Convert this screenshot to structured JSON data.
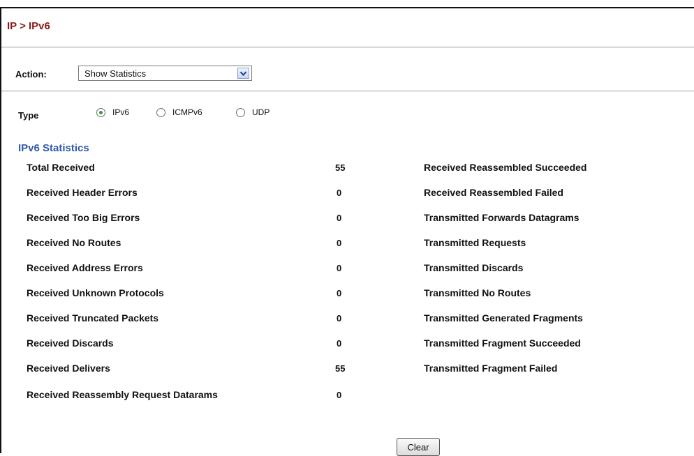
{
  "breadcrumb": "IP > IPv6",
  "action": {
    "label": "Action:",
    "selected": "Show Statistics"
  },
  "type": {
    "label": "Type",
    "options": [
      "IPv6",
      "ICMPv6",
      "UDP"
    ],
    "selected": "IPv6"
  },
  "section_title": "IPv6 Statistics",
  "left_stats": [
    {
      "label": "Total Received",
      "value": "55"
    },
    {
      "label": "Received Header Errors",
      "value": "0"
    },
    {
      "label": "Received Too Big Errors",
      "value": "0"
    },
    {
      "label": "Received No Routes",
      "value": "0"
    },
    {
      "label": "Received Address Errors",
      "value": "0"
    },
    {
      "label": "Received Unknown Protocols",
      "value": "0"
    },
    {
      "label": "Received Truncated Packets",
      "value": "0"
    },
    {
      "label": "Received Discards",
      "value": "0"
    },
    {
      "label": "Received Delivers",
      "value": "55"
    },
    {
      "label": "Received Reassembly Request Datarams",
      "value": "0"
    }
  ],
  "right_stats": [
    {
      "label": "Received Reassembled Succeeded"
    },
    {
      "label": "Received Reassembled Failed"
    },
    {
      "label": "Transmitted Forwards Datagrams"
    },
    {
      "label": "Transmitted Requests"
    },
    {
      "label": "Transmitted Discards"
    },
    {
      "label": "Transmitted No Routes"
    },
    {
      "label": "Transmitted Generated Fragments"
    },
    {
      "label": "Transmitted Fragment Succeeded"
    },
    {
      "label": "Transmitted Fragment Failed"
    }
  ],
  "clear_label": "Clear",
  "icons": {
    "dropdown": "chevron-down-icon",
    "radio_selected_color": "#2e9b3a"
  },
  "colors": {
    "breadcrumb": "#8b1a1a",
    "section_title": "#2f5aa5"
  }
}
